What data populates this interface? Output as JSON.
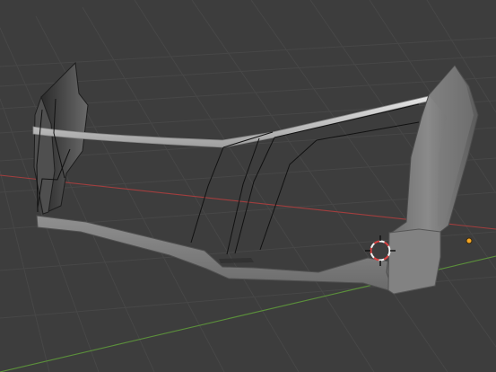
{
  "viewport": {
    "background_color": "#3d3d3d",
    "grid_color": "#484848",
    "x_axis_color": "#9b3a3a",
    "y_axis_color": "#5b8f3b"
  },
  "scene": {
    "object_light_color": "#c8c8c8",
    "object_mid_color": "#8c8c8c",
    "object_dark_color": "#2a2a2a",
    "wire_color": "#111111",
    "origin_dot_color": "#f5a623",
    "cursor_red": "#d84242",
    "cursor_white": "#f2f2f2"
  },
  "icons": {
    "cursor": "3d-cursor-icon",
    "origin": "object-origin-icon"
  }
}
